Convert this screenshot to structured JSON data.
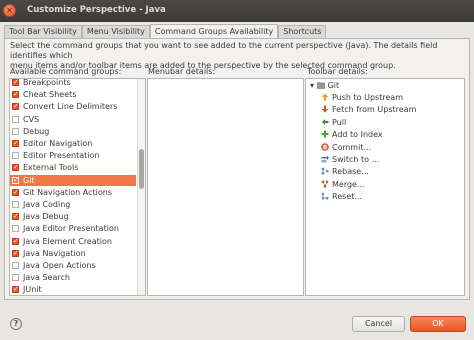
{
  "window": {
    "title": "Customize Perspective - Java",
    "close_glyph": "✕"
  },
  "tabs": [
    {
      "label": "Tool Bar Visibility",
      "active": false
    },
    {
      "label": "Menu Visibility",
      "active": false
    },
    {
      "label": "Command Groups Availability",
      "active": true
    },
    {
      "label": "Shortcuts",
      "active": false
    }
  ],
  "description": {
    "line1": "Select the command groups that you want to see added to the current perspective (Java).  The details field identifies which",
    "line2": "menu items and/or toolbar items are added to the perspective by the selected command group."
  },
  "labels": {
    "available": "Available command groups:",
    "menubar": "Menubar details:",
    "toolbar": "Toolbar details:"
  },
  "command_groups": [
    {
      "label": "Breakpoints",
      "checked": true,
      "selected": false
    },
    {
      "label": "Cheat Sheets",
      "checked": true,
      "selected": false
    },
    {
      "label": "Convert Line Delimiters",
      "checked": true,
      "selected": false
    },
    {
      "label": "CVS",
      "checked": false,
      "selected": false
    },
    {
      "label": "Debug",
      "checked": false,
      "selected": false
    },
    {
      "label": "Editor Navigation",
      "checked": true,
      "selected": false
    },
    {
      "label": "Editor Presentation",
      "checked": false,
      "selected": false
    },
    {
      "label": "External Tools",
      "checked": true,
      "selected": false
    },
    {
      "label": "Git",
      "checked": true,
      "selected": true
    },
    {
      "label": "Git Navigation Actions",
      "checked": true,
      "selected": false
    },
    {
      "label": "Java Coding",
      "checked": false,
      "selected": false
    },
    {
      "label": "Java Debug",
      "checked": true,
      "selected": false
    },
    {
      "label": "Java Editor Presentation",
      "checked": false,
      "selected": false
    },
    {
      "label": "Java Element Creation",
      "checked": true,
      "selected": false
    },
    {
      "label": "Java Navigation",
      "checked": true,
      "selected": false
    },
    {
      "label": "Java Open Actions",
      "checked": false,
      "selected": false
    },
    {
      "label": "Java Search",
      "checked": false,
      "selected": false
    },
    {
      "label": "JUnit",
      "checked": true,
      "selected": false
    }
  ],
  "toolbar_details": {
    "root": "Git",
    "root_expander": "▾",
    "items": [
      {
        "label": "Push to Upstream",
        "icon": "push-icon",
        "color": "#e8a21c"
      },
      {
        "label": "Fetch from Upstream",
        "icon": "fetch-icon",
        "color": "#d9541e"
      },
      {
        "label": "Pull",
        "icon": "pull-icon",
        "color": "#3c8c2e"
      },
      {
        "label": "Add to Index",
        "icon": "add-icon",
        "color": "#4aa63a"
      },
      {
        "label": "Commit...",
        "icon": "commit-icon",
        "color": "#d9541e"
      },
      {
        "label": "Switch to ...",
        "icon": "switch-icon",
        "color": "#3a6db5"
      },
      {
        "label": "Rebase...",
        "icon": "rebase-icon",
        "color": "#6a8fc7"
      },
      {
        "label": "Merge...",
        "icon": "merge-icon",
        "color": "#9c6b2e"
      },
      {
        "label": "Reset...",
        "icon": "reset-icon",
        "color": "#6a8fc7"
      }
    ]
  },
  "buttons": {
    "help": "?",
    "cancel": "Cancel",
    "ok": "OK"
  },
  "colors": {
    "accent": "#e95420",
    "selection": "#f07746"
  }
}
